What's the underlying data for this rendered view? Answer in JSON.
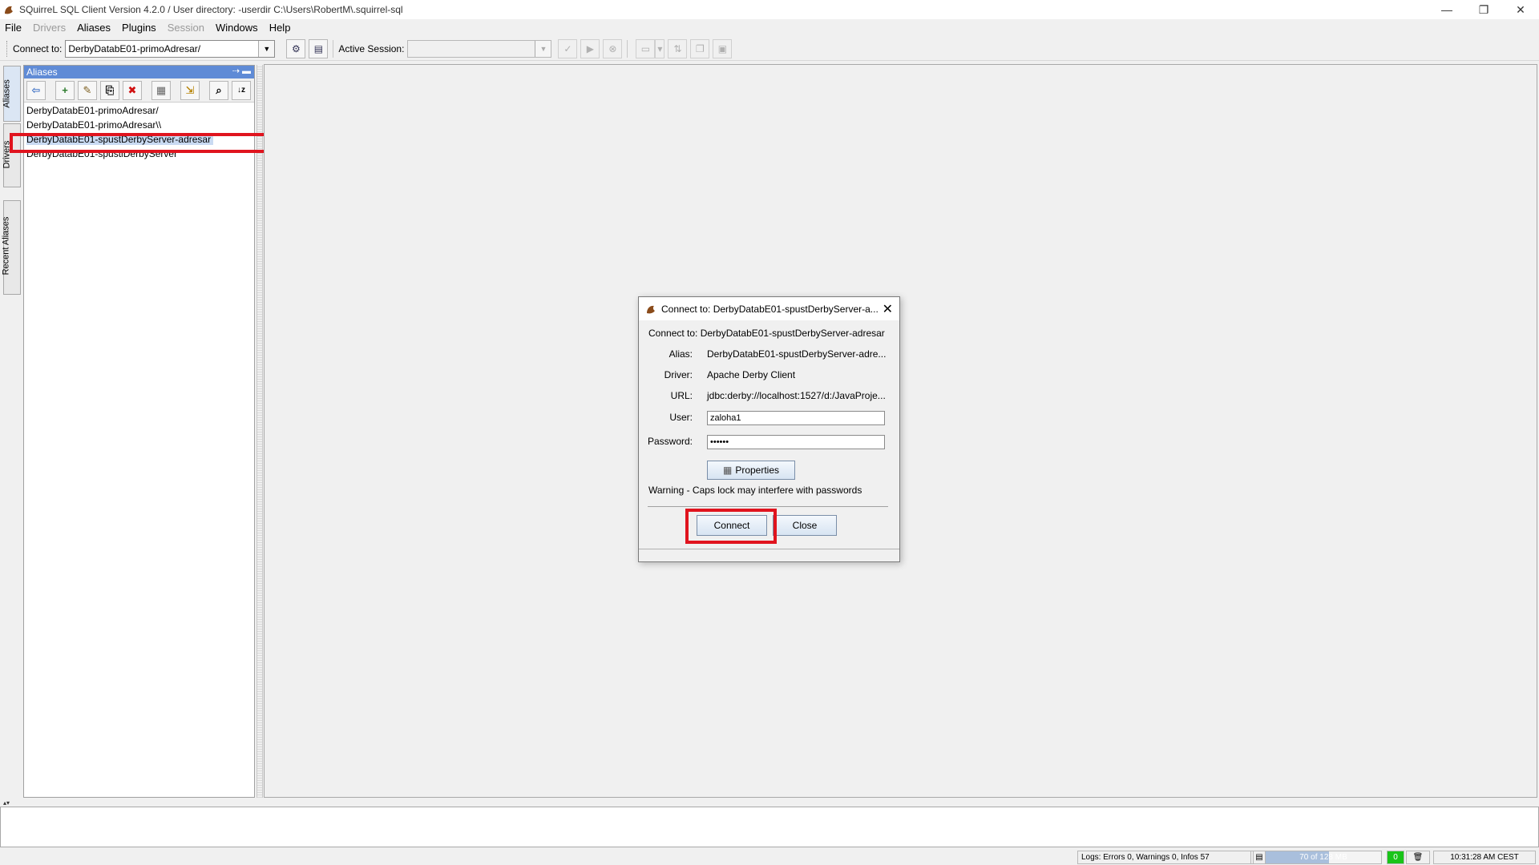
{
  "window": {
    "title": "SQuirreL SQL Client Version 4.2.0 / User directory: -userdir C:\\Users\\RobertM\\.squirrel-sql",
    "minimize": "—",
    "restore": "❐",
    "close": "✕"
  },
  "menubar": {
    "items": [
      {
        "label": "File",
        "enabled": true
      },
      {
        "label": "Drivers",
        "enabled": false
      },
      {
        "label": "Aliases",
        "enabled": true
      },
      {
        "label": "Plugins",
        "enabled": true
      },
      {
        "label": "Session",
        "enabled": false
      },
      {
        "label": "Windows",
        "enabled": true
      },
      {
        "label": "Help",
        "enabled": true
      }
    ]
  },
  "toolbar": {
    "connect_to_label": "Connect to:",
    "connect_to_value": "DerbyDatabE01-primoAdresar/",
    "active_session_label": "Active Session:",
    "active_session_value": ""
  },
  "side_tabs": {
    "aliases": "Aliases",
    "drivers": "Drivers",
    "recent": "Recent Aliases"
  },
  "aliases_panel": {
    "title": "Aliases",
    "items": [
      "DerbyDatabE01-primoAdresar/",
      "DerbyDatabE01-primoAdresar\\\\",
      "DerbyDatabE01-spustDerbyServer-adresar",
      "DerbyDatabE01-spustiDerbyServer"
    ],
    "selected_index": 2
  },
  "dialog": {
    "title": "Connect to: DerbyDatabE01-spustDerbyServer-a...",
    "connect_to_line": "Connect to: DerbyDatabE01-spustDerbyServer-adresar",
    "alias_label": "Alias:",
    "alias_value": "DerbyDatabE01-spustDerbyServer-adre...",
    "driver_label": "Driver:",
    "driver_value": "Apache Derby Client",
    "url_label": "URL:",
    "url_value": "jdbc:derby://localhost:1527/d:/JavaProje...",
    "user_label": "User:",
    "user_value": "zaloha1",
    "password_label": "Password:",
    "password_value": "••••••",
    "properties_button": "Properties",
    "warning": "Warning - Caps lock may interfere with passwords",
    "connect_button": "Connect",
    "close_button": "Close"
  },
  "statusbar": {
    "logs": "Logs: Errors 0, Warnings 0, Infos 57",
    "memory": "70 of 128 MB",
    "memory_used_fraction": 0.55,
    "gc_count": "0",
    "clock": "10:31:28 AM CEST"
  },
  "colors": {
    "highlight": "#e0141e",
    "panel_header": "#5f8bd6",
    "selection": "#c9daf2"
  }
}
